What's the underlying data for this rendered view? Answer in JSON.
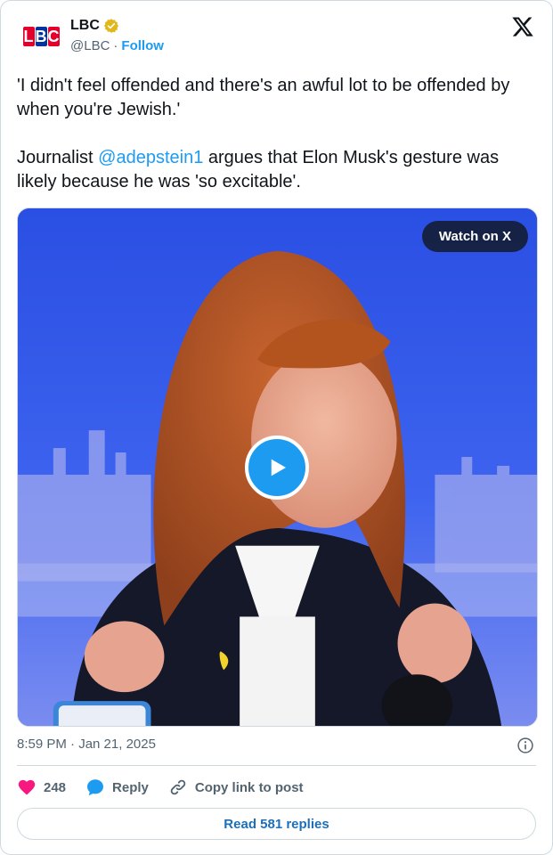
{
  "account": {
    "logo_letters": [
      "L",
      "B",
      "C"
    ],
    "display_name": "LBC",
    "verified_icon": "gold-verified-badge-icon",
    "handle": "@LBC",
    "separator": "·",
    "follow_label": "Follow"
  },
  "platform_icon": "x-logo-icon",
  "tweet": {
    "line_1": "'I didn't feel offended and there's an awful lot to be offended by when you're Jewish.'",
    "line_2_prefix": "Journalist ",
    "mention": "@adepstein1",
    "line_2_suffix": " argues that Elon Musk's gesture was likely because he was 'so excitable'."
  },
  "media": {
    "watch_label": "Watch on X",
    "play_icon": "play-icon"
  },
  "meta": {
    "timestamp": "8:59 PM · Jan 21, 2025",
    "info_icon": "info-icon"
  },
  "actions": {
    "likes": "248",
    "reply_label": "Reply",
    "copy_label": "Copy link to post"
  },
  "read_replies_label": "Read 581 replies",
  "colors": {
    "accent": "#1d9bf0",
    "like": "#f91880",
    "text": "#0f1419",
    "muted": "#536471",
    "border": "#cfd9de"
  }
}
